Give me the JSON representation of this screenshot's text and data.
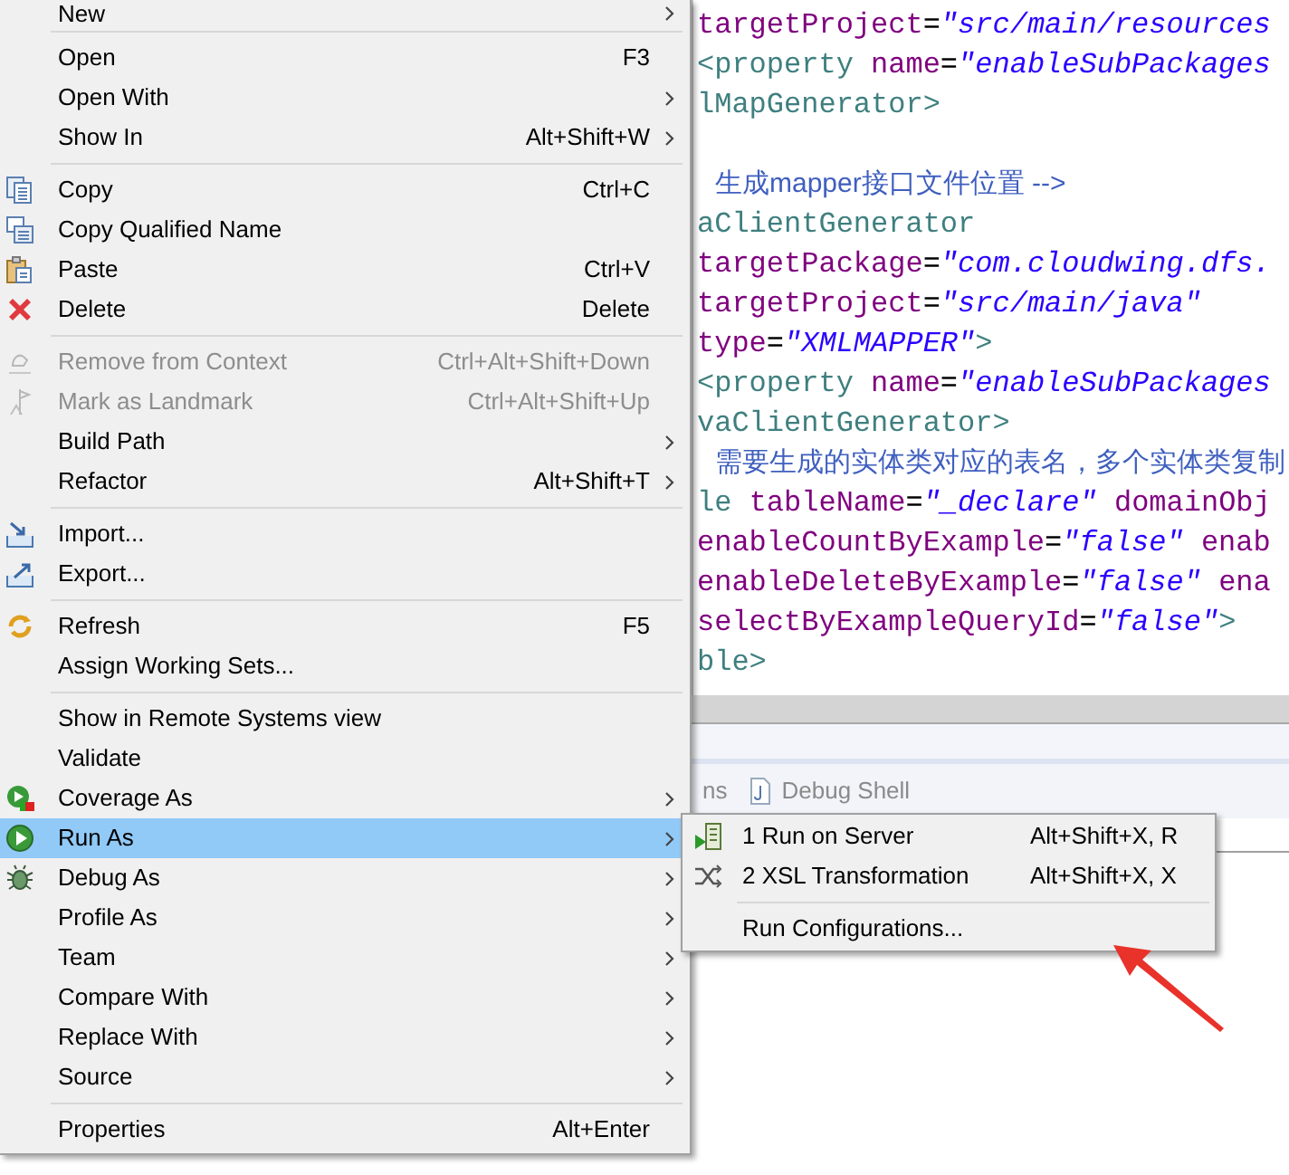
{
  "menu": {
    "items": [
      {
        "kind": "item",
        "label": "New",
        "has_submenu": true,
        "disabled": false,
        "selected": false
      },
      {
        "kind": "separator"
      },
      {
        "kind": "item",
        "label": "Open",
        "shortcut": "F3",
        "has_submenu": false,
        "disabled": false,
        "selected": false
      },
      {
        "kind": "item",
        "label": "Open With",
        "has_submenu": true,
        "disabled": false,
        "selected": false
      },
      {
        "kind": "item",
        "label": "Show In",
        "shortcut": "Alt+Shift+W",
        "has_submenu": true,
        "disabled": false,
        "selected": false
      },
      {
        "kind": "separator"
      },
      {
        "kind": "item",
        "label": "Copy",
        "shortcut": "Ctrl+C",
        "has_submenu": false,
        "disabled": false,
        "selected": false
      },
      {
        "kind": "item",
        "label": "Copy Qualified Name",
        "has_submenu": false,
        "disabled": false,
        "selected": false
      },
      {
        "kind": "item",
        "label": "Paste",
        "shortcut": "Ctrl+V",
        "has_submenu": false,
        "disabled": false,
        "selected": false
      },
      {
        "kind": "item",
        "label": "Delete",
        "shortcut": "Delete",
        "has_submenu": false,
        "disabled": false,
        "selected": false
      },
      {
        "kind": "separator"
      },
      {
        "kind": "item",
        "label": "Remove from Context",
        "shortcut": "Ctrl+Alt+Shift+Down",
        "has_submenu": false,
        "disabled": true,
        "selected": false
      },
      {
        "kind": "item",
        "label": "Mark as Landmark",
        "shortcut": "Ctrl+Alt+Shift+Up",
        "has_submenu": false,
        "disabled": true,
        "selected": false
      },
      {
        "kind": "item",
        "label": "Build Path",
        "has_submenu": true,
        "disabled": false,
        "selected": false
      },
      {
        "kind": "item",
        "label": "Refactor",
        "shortcut": "Alt+Shift+T",
        "has_submenu": true,
        "disabled": false,
        "selected": false
      },
      {
        "kind": "separator"
      },
      {
        "kind": "item",
        "label": "Import...",
        "has_submenu": false,
        "disabled": false,
        "selected": false
      },
      {
        "kind": "item",
        "label": "Export...",
        "has_submenu": false,
        "disabled": false,
        "selected": false
      },
      {
        "kind": "separator"
      },
      {
        "kind": "item",
        "label": "Refresh",
        "shortcut": "F5",
        "has_submenu": false,
        "disabled": false,
        "selected": false
      },
      {
        "kind": "item",
        "label": "Assign Working Sets...",
        "has_submenu": false,
        "disabled": false,
        "selected": false
      },
      {
        "kind": "separator"
      },
      {
        "kind": "item",
        "label": "Show in Remote Systems view",
        "has_submenu": false,
        "disabled": false,
        "selected": false
      },
      {
        "kind": "item",
        "label": "Validate",
        "has_submenu": false,
        "disabled": false,
        "selected": false
      },
      {
        "kind": "item",
        "label": "Coverage As",
        "has_submenu": true,
        "disabled": false,
        "selected": false
      },
      {
        "kind": "item",
        "label": "Run As",
        "has_submenu": true,
        "disabled": false,
        "selected": true
      },
      {
        "kind": "item",
        "label": "Debug As",
        "has_submenu": true,
        "disabled": false,
        "selected": false
      },
      {
        "kind": "item",
        "label": "Profile As",
        "has_submenu": true,
        "disabled": false,
        "selected": false
      },
      {
        "kind": "item",
        "label": "Team",
        "has_submenu": true,
        "disabled": false,
        "selected": false
      },
      {
        "kind": "item",
        "label": "Compare With",
        "has_submenu": true,
        "disabled": false,
        "selected": false
      },
      {
        "kind": "item",
        "label": "Replace With",
        "has_submenu": true,
        "disabled": false,
        "selected": false
      },
      {
        "kind": "item",
        "label": "Source",
        "has_submenu": true,
        "disabled": false,
        "selected": false
      },
      {
        "kind": "separator"
      },
      {
        "kind": "item",
        "label": "Properties",
        "shortcut": "Alt+Enter",
        "has_submenu": false,
        "disabled": false,
        "selected": false
      }
    ]
  },
  "submenu": {
    "items": [
      {
        "kind": "item",
        "label": "1 Run on Server",
        "shortcut": "Alt+Shift+X, R"
      },
      {
        "kind": "item",
        "label": "2 XSL Transformation",
        "shortcut": "Alt+Shift+X, X"
      },
      {
        "kind": "separator"
      },
      {
        "kind": "item",
        "label": "Run Configurations..."
      }
    ]
  },
  "editor": {
    "lines": [
      {
        "kind": "code",
        "segments": [
          {
            "kind": "attr",
            "text": "targetProject"
          },
          {
            "kind": "plain",
            "text": "="
          },
          {
            "kind": "value",
            "text": "\"src/main/resources"
          }
        ]
      },
      {
        "kind": "code",
        "segments": [
          {
            "kind": "tag",
            "text": "<property "
          },
          {
            "kind": "attr",
            "text": "name"
          },
          {
            "kind": "plain",
            "text": "="
          },
          {
            "kind": "value",
            "text": "\"enableSubPackages"
          }
        ]
      },
      {
        "kind": "code",
        "segments": [
          {
            "kind": "tag",
            "text": "lMapGenerator>"
          }
        ]
      },
      {
        "kind": "blank"
      },
      {
        "kind": "code",
        "segments": [
          {
            "kind": "comment",
            "text": "生成mapper接口文件位置 -->"
          }
        ]
      },
      {
        "kind": "code",
        "segments": [
          {
            "kind": "tag",
            "text": "aClientGenerator"
          }
        ]
      },
      {
        "kind": "code",
        "segments": [
          {
            "kind": "attr",
            "text": "targetPackage"
          },
          {
            "kind": "plain",
            "text": "="
          },
          {
            "kind": "value",
            "text": "\"com.cloudwing.dfs."
          }
        ]
      },
      {
        "kind": "code",
        "segments": [
          {
            "kind": "attr",
            "text": "targetProject"
          },
          {
            "kind": "plain",
            "text": "="
          },
          {
            "kind": "value",
            "text": "\"src/main/java\""
          }
        ]
      },
      {
        "kind": "code",
        "segments": [
          {
            "kind": "attr",
            "text": "type"
          },
          {
            "kind": "plain",
            "text": "="
          },
          {
            "kind": "value",
            "text": "\"XMLMAPPER\""
          },
          {
            "kind": "tag",
            "text": ">"
          }
        ]
      },
      {
        "kind": "code",
        "segments": [
          {
            "kind": "tag",
            "text": "<property "
          },
          {
            "kind": "attr",
            "text": "name"
          },
          {
            "kind": "plain",
            "text": "="
          },
          {
            "kind": "value",
            "text": "\"enableSubPackages"
          }
        ]
      },
      {
        "kind": "code",
        "segments": [
          {
            "kind": "tag",
            "text": "vaClientGenerator>"
          }
        ]
      },
      {
        "kind": "code",
        "segments": [
          {
            "kind": "comment",
            "text": "需要生成的实体类对应的表名，多个实体类复制"
          }
        ]
      },
      {
        "kind": "code",
        "segments": [
          {
            "kind": "tag",
            "text": "le "
          },
          {
            "kind": "attr",
            "text": "tableName"
          },
          {
            "kind": "plain",
            "text": "="
          },
          {
            "kind": "value",
            "text": "\"_declare\" "
          },
          {
            "kind": "attr",
            "text": "domainObj"
          }
        ]
      },
      {
        "kind": "code",
        "segments": [
          {
            "kind": "attr",
            "text": "enableCountByExample"
          },
          {
            "kind": "plain",
            "text": "="
          },
          {
            "kind": "value",
            "text": "\"false\" "
          },
          {
            "kind": "attr",
            "text": "enab"
          }
        ]
      },
      {
        "kind": "code",
        "segments": [
          {
            "kind": "attr",
            "text": "enableDeleteByExample"
          },
          {
            "kind": "plain",
            "text": "="
          },
          {
            "kind": "value",
            "text": "\"false\" "
          },
          {
            "kind": "attr",
            "text": "ena"
          }
        ]
      },
      {
        "kind": "code",
        "segments": [
          {
            "kind": "attr",
            "text": "selectByExampleQueryId"
          },
          {
            "kind": "plain",
            "text": "="
          },
          {
            "kind": "value",
            "text": "\"false\""
          },
          {
            "kind": "tag",
            "text": ">"
          }
        ]
      },
      {
        "kind": "code",
        "segments": [
          {
            "kind": "tag",
            "text": "ble>"
          }
        ]
      }
    ]
  },
  "panel": {
    "tabs": [
      {
        "label": "ns"
      },
      {
        "label": "Debug Shell"
      }
    ]
  }
}
